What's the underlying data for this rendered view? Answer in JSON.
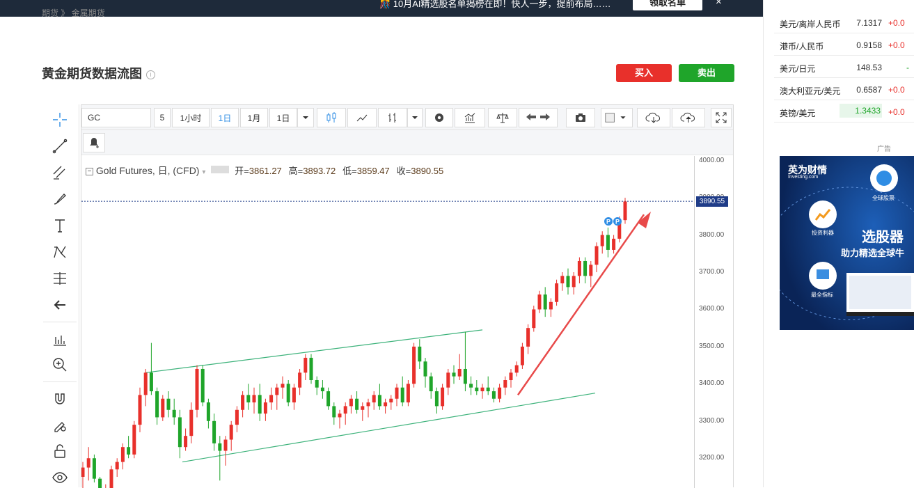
{
  "banner": {
    "text": "🎊 10月AI精选股名单揭榜在即！快人一步，提前布局……",
    "button": "领取名单",
    "close": "×"
  },
  "breadcrumb": "期货 》 金属期货",
  "page": {
    "title": "黄金期货数据流图",
    "info": "i",
    "buy_label": "买入",
    "sell_label": "卖出"
  },
  "toolbar": {
    "symbol": "GC",
    "interval_input": "5",
    "intervals": [
      "1小时",
      "1日",
      "1月"
    ],
    "range": "1日"
  },
  "chart_legend": {
    "name": "Gold Futures, 日, (CFD)",
    "open_label": "开=",
    "open": "3861.27",
    "high_label": "高=",
    "high": "3893.72",
    "low_label": "低=",
    "low": "3859.47",
    "close_label": "收=",
    "close": "3890.55"
  },
  "chart_data": {
    "type": "candlestick",
    "title": "Gold Futures, 日, (CFD)",
    "y_ticks": [
      "4000.00",
      "3900.00",
      "3800.00",
      "3700.00",
      "3600.00",
      "3500.00",
      "3400.00",
      "3300.00",
      "3200.00"
    ],
    "ylim": [
      3120,
      4005
    ],
    "last_price": "3890.55",
    "candles": [
      [
        3150,
        3190,
        3100,
        3175
      ],
      [
        3175,
        3230,
        3140,
        3200
      ],
      [
        3200,
        3210,
        3135,
        3145
      ],
      [
        3145,
        3150,
        3080,
        3100
      ],
      [
        3100,
        3130,
        3080,
        3120
      ],
      [
        3120,
        3180,
        3110,
        3170
      ],
      [
        3170,
        3200,
        3150,
        3190
      ],
      [
        3190,
        3240,
        3170,
        3230
      ],
      [
        3230,
        3260,
        3200,
        3210
      ],
      [
        3210,
        3300,
        3200,
        3290
      ],
      [
        3290,
        3390,
        3270,
        3370
      ],
      [
        3370,
        3440,
        3340,
        3430
      ],
      [
        3430,
        3510,
        3370,
        3380
      ],
      [
        3380,
        3390,
        3290,
        3310
      ],
      [
        3310,
        3370,
        3300,
        3360
      ],
      [
        3360,
        3380,
        3310,
        3330
      ],
      [
        3330,
        3360,
        3290,
        3310
      ],
      [
        3310,
        3330,
        3200,
        3230
      ],
      [
        3230,
        3280,
        3220,
        3260
      ],
      [
        3260,
        3350,
        3240,
        3330
      ],
      [
        3330,
        3450,
        3310,
        3440
      ],
      [
        3440,
        3450,
        3340,
        3350
      ],
      [
        3350,
        3360,
        3280,
        3300
      ],
      [
        3300,
        3320,
        3220,
        3240
      ],
      [
        3240,
        3260,
        3140,
        3220
      ],
      [
        3220,
        3260,
        3180,
        3250
      ],
      [
        3250,
        3300,
        3220,
        3290
      ],
      [
        3290,
        3340,
        3270,
        3330
      ],
      [
        3330,
        3380,
        3310,
        3370
      ],
      [
        3370,
        3400,
        3330,
        3350
      ],
      [
        3350,
        3390,
        3320,
        3370
      ],
      [
        3370,
        3400,
        3300,
        3320
      ],
      [
        3320,
        3360,
        3300,
        3350
      ],
      [
        3350,
        3390,
        3330,
        3370
      ],
      [
        3370,
        3400,
        3330,
        3390
      ],
      [
        3390,
        3420,
        3360,
        3400
      ],
      [
        3400,
        3410,
        3340,
        3350
      ],
      [
        3350,
        3400,
        3330,
        3390
      ],
      [
        3390,
        3440,
        3370,
        3430
      ],
      [
        3430,
        3480,
        3410,
        3470
      ],
      [
        3470,
        3480,
        3400,
        3410
      ],
      [
        3410,
        3420,
        3370,
        3390
      ],
      [
        3390,
        3410,
        3360,
        3380
      ],
      [
        3380,
        3390,
        3330,
        3340
      ],
      [
        3340,
        3350,
        3290,
        3310
      ],
      [
        3310,
        3330,
        3280,
        3320
      ],
      [
        3320,
        3350,
        3290,
        3340
      ],
      [
        3340,
        3370,
        3320,
        3360
      ],
      [
        3360,
        3380,
        3320,
        3330
      ],
      [
        3330,
        3350,
        3300,
        3340
      ],
      [
        3340,
        3360,
        3310,
        3350
      ],
      [
        3350,
        3380,
        3330,
        3370
      ],
      [
        3370,
        3400,
        3330,
        3340
      ],
      [
        3340,
        3360,
        3320,
        3350
      ],
      [
        3350,
        3370,
        3330,
        3360
      ],
      [
        3360,
        3400,
        3340,
        3390
      ],
      [
        3390,
        3420,
        3340,
        3350
      ],
      [
        3350,
        3410,
        3340,
        3400
      ],
      [
        3400,
        3510,
        3390,
        3500
      ],
      [
        3500,
        3520,
        3440,
        3460
      ],
      [
        3460,
        3470,
        3390,
        3420
      ],
      [
        3420,
        3430,
        3360,
        3380
      ],
      [
        3380,
        3390,
        3320,
        3340
      ],
      [
        3340,
        3400,
        3330,
        3390
      ],
      [
        3390,
        3440,
        3370,
        3430
      ],
      [
        3430,
        3450,
        3400,
        3420
      ],
      [
        3420,
        3480,
        3410,
        3440
      ],
      [
        3440,
        3540,
        3380,
        3400
      ],
      [
        3400,
        3420,
        3370,
        3390
      ],
      [
        3390,
        3410,
        3370,
        3380
      ],
      [
        3380,
        3400,
        3360,
        3390
      ],
      [
        3390,
        3420,
        3370,
        3380
      ],
      [
        3380,
        3390,
        3350,
        3360
      ],
      [
        3360,
        3400,
        3350,
        3390
      ],
      [
        3390,
        3420,
        3370,
        3410
      ],
      [
        3410,
        3440,
        3390,
        3430
      ],
      [
        3430,
        3460,
        3420,
        3450
      ],
      [
        3450,
        3510,
        3440,
        3500
      ],
      [
        3500,
        3560,
        3480,
        3550
      ],
      [
        3550,
        3610,
        3540,
        3600
      ],
      [
        3600,
        3650,
        3590,
        3640
      ],
      [
        3640,
        3660,
        3580,
        3600
      ],
      [
        3600,
        3630,
        3580,
        3620
      ],
      [
        3620,
        3680,
        3610,
        3670
      ],
      [
        3670,
        3700,
        3650,
        3690
      ],
      [
        3690,
        3710,
        3640,
        3660
      ],
      [
        3660,
        3700,
        3640,
        3690
      ],
      [
        3690,
        3740,
        3670,
        3730
      ],
      [
        3730,
        3740,
        3670,
        3690
      ],
      [
        3690,
        3730,
        3660,
        3720
      ],
      [
        3720,
        3780,
        3700,
        3770
      ],
      [
        3770,
        3810,
        3750,
        3800
      ],
      [
        3800,
        3820,
        3740,
        3760
      ],
      [
        3760,
        3800,
        3750,
        3790
      ],
      [
        3790,
        3850,
        3780,
        3840
      ],
      [
        3840,
        3900,
        3830,
        3890
      ]
    ]
  },
  "quotes": [
    {
      "name": "美元/离岸人民币",
      "price": "7.1317",
      "change": "+0.0"
    },
    {
      "name": "港币/人民币",
      "price": "0.9158",
      "change": "+0.0"
    },
    {
      "name": "美元/日元",
      "price": "148.53",
      "change": "-"
    },
    {
      "name": "澳大利亚元/美元",
      "price": "0.6587",
      "change": "+0.0"
    },
    {
      "name": "英镑/美元",
      "price": "1.3433",
      "change": "+0.0"
    }
  ],
  "ad": {
    "label": "广告",
    "brand": "英为财情",
    "brand_sub": "Investing.com",
    "global_stocks": "全球股票",
    "invest_profit": "投资利器",
    "headline": "选股器",
    "subline": "助力精选全球牛",
    "indicators": "最全指标"
  },
  "colors": {
    "up": "#e8302b",
    "down": "#1fa52a",
    "channel": "#3cb27a",
    "arrow": "#e84a4a",
    "price_line": "#1f3c88"
  }
}
